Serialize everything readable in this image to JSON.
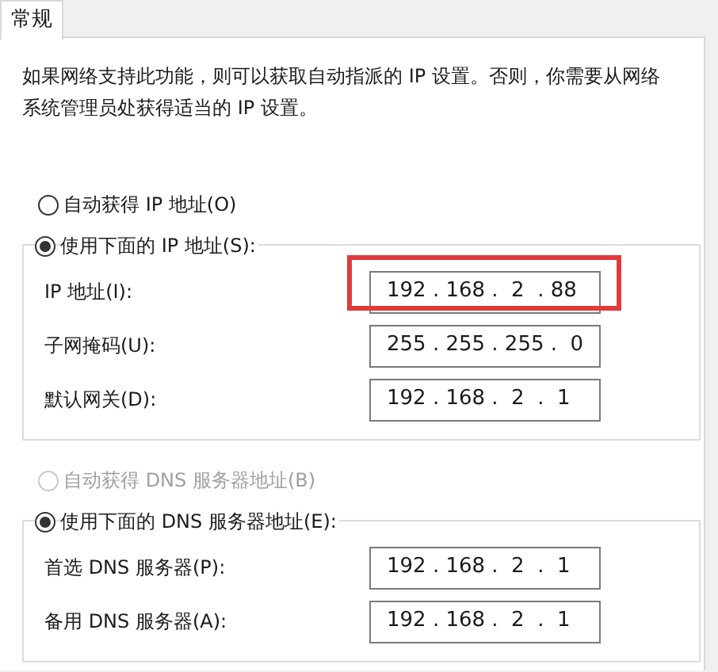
{
  "tabs": [
    {
      "label": "常规",
      "selected": true
    }
  ],
  "description": "如果网络支持此功能，则可以获取自动指派的 IP 设置。否则，你需要从网络系统管理员处获得适当的 IP 设置。",
  "ip_mode": [
    {
      "label": "自动获得 IP 地址(O)",
      "selected": false,
      "disabled": false
    },
    {
      "label": "使用下面的 IP 地址(S):",
      "selected": true,
      "disabled": false,
      "fields": [
        {
          "label": "IP 地址(I):",
          "value": "192 . 168 .  2  . 88",
          "highlighted": true
        },
        {
          "label": "子网掩码(U):",
          "value": "255 . 255 . 255 .  0",
          "highlighted": false
        },
        {
          "label": "默认网关(D):",
          "value": "192 . 168 .  2  .  1",
          "highlighted": false
        }
      ]
    }
  ],
  "dns_mode": [
    {
      "label": "自动获得 DNS 服务器地址(B)",
      "selected": false,
      "disabled": true
    },
    {
      "label": "使用下面的 DNS 服务器地址(E):",
      "selected": true,
      "disabled": false,
      "fields": [
        {
          "label": "首选 DNS 服务器(P):",
          "value": "192 . 168 .  2  .  1",
          "highlighted": false
        },
        {
          "label": "备用 DNS 服务器(A):",
          "value": "192 . 168 .  2  .  1",
          "highlighted": false
        }
      ]
    }
  ]
}
